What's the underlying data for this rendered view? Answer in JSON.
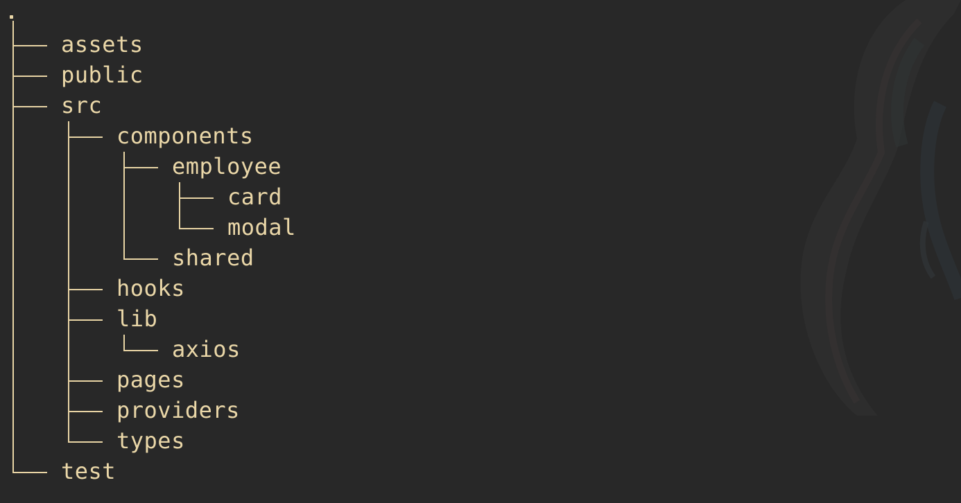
{
  "terminal": {
    "root_label": ".",
    "tree": [
      {
        "name": "assets",
        "depth": 0
      },
      {
        "name": "public",
        "depth": 0
      },
      {
        "name": "src",
        "depth": 0
      },
      {
        "name": "components",
        "depth": 1
      },
      {
        "name": "employee",
        "depth": 2
      },
      {
        "name": "card",
        "depth": 3
      },
      {
        "name": "modal",
        "depth": 3
      },
      {
        "name": "shared",
        "depth": 2
      },
      {
        "name": "hooks",
        "depth": 1
      },
      {
        "name": "lib",
        "depth": 1
      },
      {
        "name": "axios",
        "depth": 2
      },
      {
        "name": "pages",
        "depth": 1
      },
      {
        "name": "providers",
        "depth": 1
      },
      {
        "name": "types",
        "depth": 1
      },
      {
        "name": "test",
        "depth": 0
      }
    ],
    "colors": {
      "background": "#282828",
      "text": "#ead7a8",
      "lines": "#e9d5a5"
    },
    "background_art": "abstract-creature-wallpaper-icon"
  }
}
